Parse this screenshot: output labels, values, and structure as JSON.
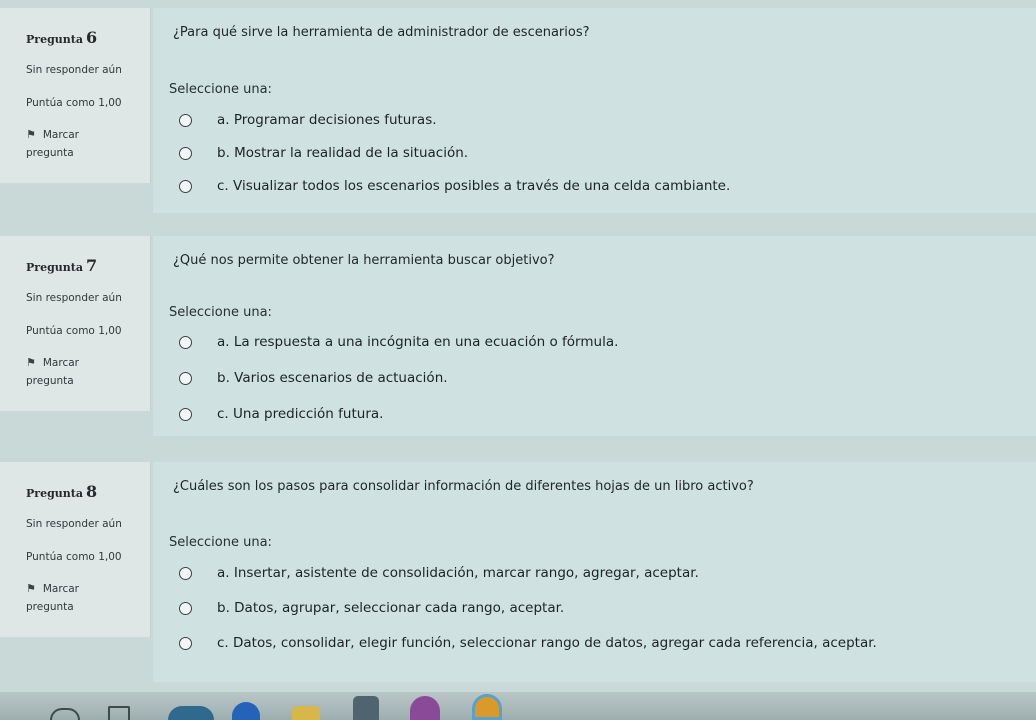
{
  "questions": [
    {
      "label": "Pregunta",
      "number": "6",
      "status": "Sin responder aún",
      "points": "Puntúa como 1,00",
      "flag_line1": "Marcar",
      "flag_line2": "pregunta",
      "text": "¿Para qué sirve la herramienta de administrador de escenarios?",
      "prompt": "Seleccione una:",
      "options": [
        "a. Programar decisiones futuras.",
        "b. Mostrar la realidad de la situación.",
        "c. Visualizar todos los escenarios posibles a través de una celda cambiante."
      ]
    },
    {
      "label": "Pregunta",
      "number": "7",
      "status": "Sin responder aún",
      "points": "Puntúa como 1,00",
      "flag_line1": "Marcar",
      "flag_line2": "pregunta",
      "text": "¿Qué nos permite obtener la herramienta buscar objetivo?",
      "prompt": "Seleccione una:",
      "options": [
        "a. La respuesta a una incógnita en una ecuación o fórmula.",
        "b. Varios escenarios de actuación.",
        "c. Una predicción futura."
      ]
    },
    {
      "label": "Pregunta",
      "number": "8",
      "status": "Sin responder aún",
      "points": "Puntúa como 1,00",
      "flag_line1": "Marcar",
      "flag_line2": "pregunta",
      "text": "¿Cuáles son los pasos para consolidar información de diferentes hojas de un libro activo?",
      "prompt": "Seleccione una:",
      "options": [
        "a. Insertar, asistente de consolidación, marcar rango, agregar, aceptar.",
        "b. Datos, agrupar, seleccionar cada rango, aceptar.",
        "c. Datos, consolidar, elegir función, seleccionar rango de datos, agregar cada referencia, aceptar."
      ]
    }
  ],
  "taskbar": {
    "icons": [
      "search-icon",
      "task-view-icon",
      "edge-browser-icon",
      "file-explorer-icon",
      "store-icon",
      "app-icon",
      "chrome-icon"
    ]
  },
  "colors": {
    "background": "#c9d9d8",
    "info_panel": "#dfe7e6",
    "content_panel": "#cfe1e0",
    "text": "#1d2224"
  }
}
